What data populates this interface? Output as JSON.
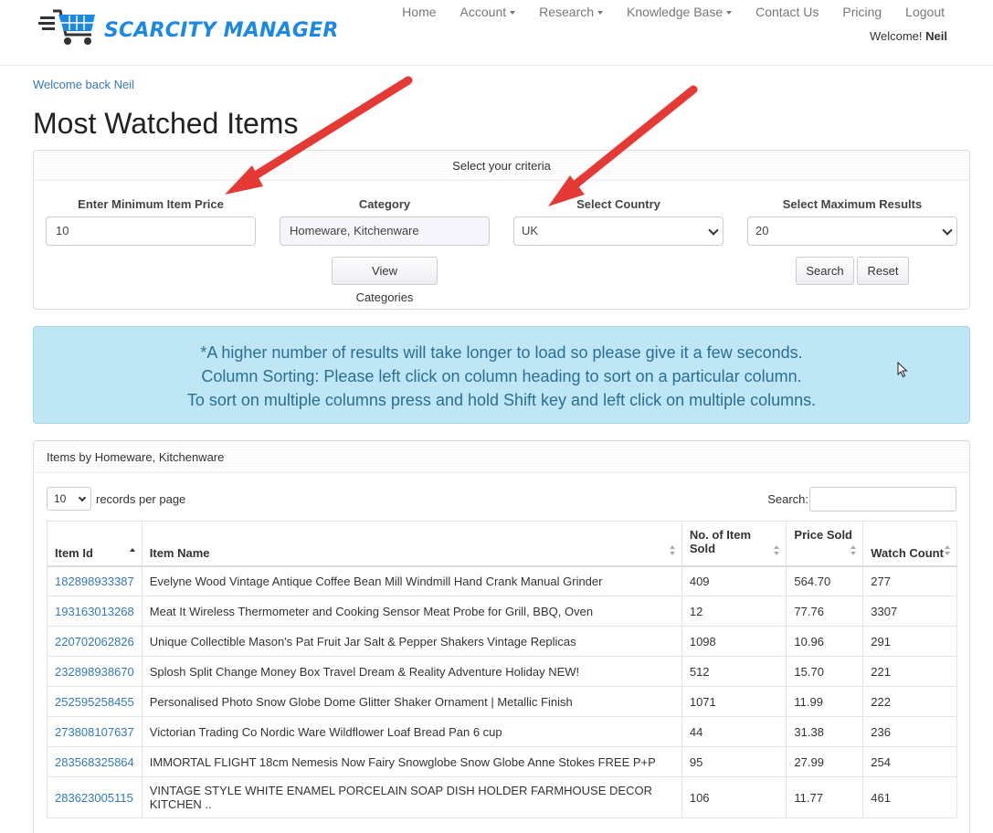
{
  "brand": {
    "name": "SCARCITY MANAGER",
    "color": "#1e88e5"
  },
  "nav": {
    "items": [
      {
        "label": "Home",
        "dropdown": false
      },
      {
        "label": "Account",
        "dropdown": true
      },
      {
        "label": "Research",
        "dropdown": true
      },
      {
        "label": "Knowledge Base",
        "dropdown": true
      },
      {
        "label": "Contact Us",
        "dropdown": false
      },
      {
        "label": "Pricing",
        "dropdown": false
      },
      {
        "label": "Logout",
        "dropdown": false
      }
    ],
    "welcome_prefix": "Welcome!",
    "welcome_user": "Neil"
  },
  "welcome_link": "Welcome back Neil",
  "page_title": "Most Watched Items",
  "criteria": {
    "heading": "Select your criteria",
    "min_price_label": "Enter Minimum Item Price",
    "min_price_value": "10",
    "category_label": "Category",
    "category_value": "Homeware, Kitchenware",
    "country_label": "Select Country",
    "country_value": "UK",
    "max_results_label": "Select Maximum Results",
    "max_results_value": "20",
    "view_categories_btn": "View Categories",
    "search_btn": "Search",
    "reset_btn": "Reset"
  },
  "alert": {
    "line1": "*A higher number of results will take longer to load so please give it a few seconds.",
    "line2": "Column Sorting: Please left click on column heading to sort on a particular column.",
    "line3": "To sort on multiple columns press and hold Shift key and left click on multiple columns.",
    "bg_color": "#bfe6f5",
    "text_color": "#2a6f95"
  },
  "results": {
    "heading": "Items by Homeware, Kitchenware",
    "records_per_page": "10",
    "records_label": "records per page",
    "search_label": "Search:",
    "columns": [
      "Item Id",
      "Item Name",
      "No. of Item Sold",
      "Price Sold",
      "Watch Count"
    ],
    "rows": [
      {
        "id": "182898933387",
        "name": "Evelyne Wood Vintage Antique Coffee Bean Mill Windmill Hand Crank Manual Grinder",
        "sold": "409",
        "price": "564.70",
        "watch": "277"
      },
      {
        "id": "193163013268",
        "name": "Meat It Wireless Thermometer and Cooking Sensor Meat Probe for Grill, BBQ, Oven",
        "sold": "12",
        "price": "77.76",
        "watch": "3307"
      },
      {
        "id": "220702062826",
        "name": "Unique Collectible Mason's Pat Fruit Jar Salt & Pepper Shakers Vintage Replicas",
        "sold": "1098",
        "price": "10.96",
        "watch": "291"
      },
      {
        "id": "232898938670",
        "name": "Splosh Split Change Money Box Travel Dream & Reality Adventure Holiday NEW!",
        "sold": "512",
        "price": "15.70",
        "watch": "221"
      },
      {
        "id": "252595258455",
        "name": "Personalised Photo Snow Globe Dome Glitter Shaker Ornament | Metallic Finish",
        "sold": "1071",
        "price": "11.99",
        "watch": "222"
      },
      {
        "id": "273808107637",
        "name": "Victorian Trading Co Nordic Ware Wildflower Loaf Bread Pan 6 cup",
        "sold": "44",
        "price": "31.38",
        "watch": "236"
      },
      {
        "id": "283568325864",
        "name": "IMMORTAL FLIGHT 18cm Nemesis Now Fairy Snowglobe Snow Globe Anne Stokes FREE P+P",
        "sold": "95",
        "price": "27.99",
        "watch": "254"
      },
      {
        "id": "283623005115",
        "name": "VINTAGE STYLE WHITE ENAMEL PORCELAIN SOAP DISH HOLDER FARMHOUSE DECOR KITCHEN ..",
        "sold": "106",
        "price": "11.77",
        "watch": "461"
      }
    ]
  },
  "annotation_color": "#e53935"
}
